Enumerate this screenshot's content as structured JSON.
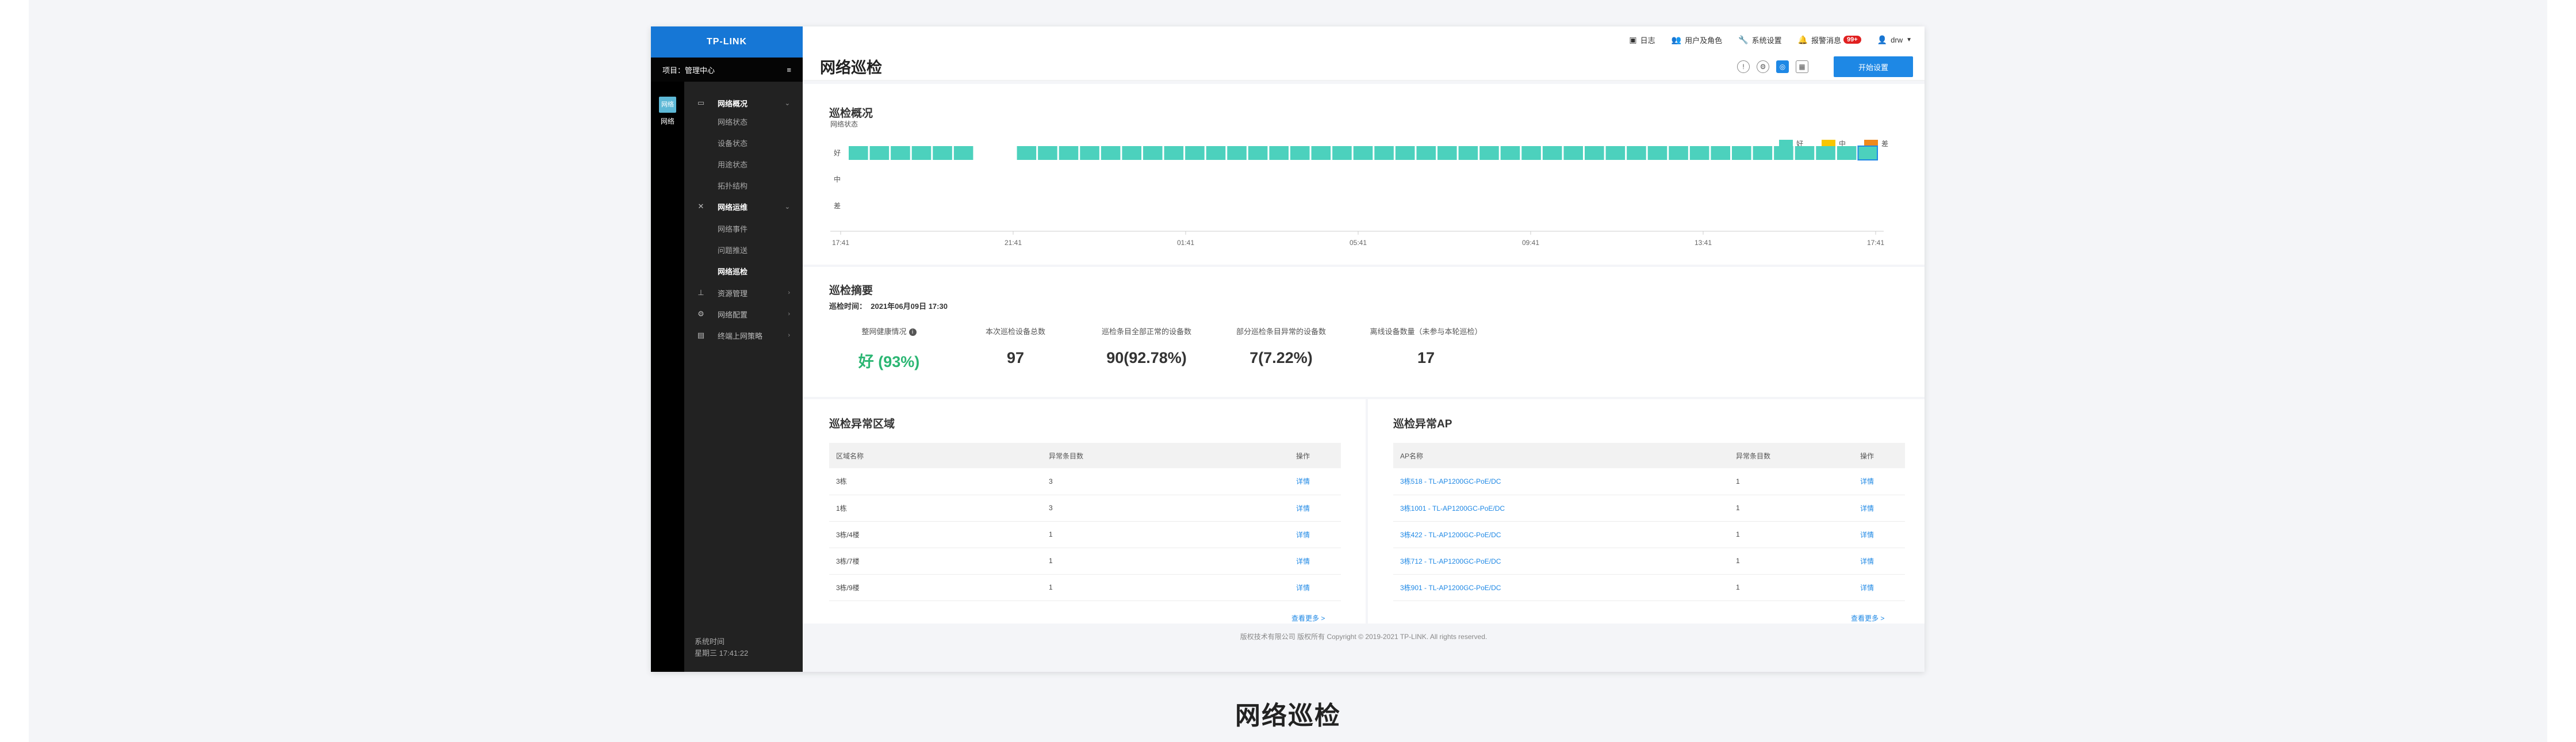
{
  "brand": {
    "logo": "TP-LINK"
  },
  "project": {
    "label": "项目：管理中心",
    "menu_icon": "hamburger-icon"
  },
  "rail": {
    "icon_text": "网络",
    "label": "网络"
  },
  "nav": {
    "groups": [
      {
        "label": "网络概况",
        "icon": "monitor-icon",
        "children": [
          "网络状态",
          "设备状态",
          "用途状态",
          "拓扑结构"
        ]
      },
      {
        "label": "网络运维",
        "icon": "tools-icon",
        "children": [
          "网络事件",
          "问题推送",
          "网络巡检"
        ]
      },
      {
        "label": "资源管理",
        "icon": "sitemap-icon",
        "children": []
      },
      {
        "label": "网络配置",
        "icon": "gear-icon",
        "children": []
      },
      {
        "label": "终端上网策略",
        "icon": "terminal-icon",
        "children": []
      }
    ],
    "active_child": "网络巡检"
  },
  "system_time": {
    "label": "系统时间",
    "value": "星期三 17:41:22"
  },
  "topbar": {
    "log": "日志",
    "users": "用户及角色",
    "settings": "系统设置",
    "alerts": "报警消息",
    "alert_count": "99+",
    "user": "drw"
  },
  "page": {
    "title": "网络巡检",
    "start_button": "开始设置"
  },
  "overview": {
    "title": "巡检概况"
  },
  "chart_data": {
    "type": "bar",
    "title": "巡检概况",
    "ylabel": "网络状态",
    "y_categories": [
      "好",
      "中",
      "差"
    ],
    "x_ticks": [
      "17:41",
      "21:41",
      "01:41",
      "05:41",
      "09:41",
      "13:41",
      "17:41"
    ],
    "legend": [
      {
        "label": "好",
        "color": "#4cd1bd"
      },
      {
        "label": "中",
        "color": "#f8c600"
      },
      {
        "label": "差",
        "color": "#f08a1c"
      }
    ],
    "legend_position": "top-right",
    "bars": 48,
    "gap_after": 6,
    "values": [
      "好",
      "好",
      "好",
      "好",
      "好",
      "好",
      "",
      "好",
      "好",
      "好",
      "好",
      "好",
      "好",
      "好",
      "好",
      "好",
      "好",
      "好",
      "好",
      "好",
      "好",
      "好",
      "好",
      "好",
      "好",
      "好",
      "好",
      "好",
      "好",
      "好",
      "好",
      "好",
      "好",
      "好",
      "好",
      "好",
      "好",
      "好",
      "好",
      "好",
      "好",
      "好",
      "好",
      "好",
      "好",
      "好",
      "好",
      "好"
    ],
    "highlight_last": true
  },
  "summary": {
    "title": "巡检摘要",
    "time_label": "巡检时间：",
    "time_value": "2021年06月09日 17:30",
    "stats": [
      {
        "label": "整网健康情况",
        "value": "好 (93%)"
      },
      {
        "label": "本次巡检设备总数",
        "value": "97"
      },
      {
        "label": "巡检条目全部正常的设备数",
        "value": "90(92.78%)"
      },
      {
        "label": "部分巡检条目异常的设备数",
        "value": "7(7.22%)"
      },
      {
        "label": "离线设备数量（未参与本轮巡检）",
        "value": "17"
      }
    ]
  },
  "areas": {
    "title": "巡检异常区域",
    "headers": [
      "区域名称",
      "异常条目数",
      "操作"
    ],
    "rows": [
      [
        "3栋",
        "3",
        "详情"
      ],
      [
        "1栋",
        "3",
        "详情"
      ],
      [
        "3栋/4楼",
        "1",
        "详情"
      ],
      [
        "3栋/7楼",
        "1",
        "详情"
      ],
      [
        "3栋/9楼",
        "1",
        "详情"
      ]
    ],
    "more": "查看更多 >"
  },
  "aps": {
    "title": "巡检异常AP",
    "headers": [
      "AP名称",
      "异常条目数",
      "操作"
    ],
    "rows": [
      [
        "3栋518 - TL-AP1200GC-PoE/DC",
        "1",
        "详情"
      ],
      [
        "3栋1001 - TL-AP1200GC-PoE/DC",
        "1",
        "详情"
      ],
      [
        "3栋422 - TL-AP1200GC-PoE/DC",
        "1",
        "详情"
      ],
      [
        "3栋712 - TL-AP1200GC-PoE/DC",
        "1",
        "详情"
      ],
      [
        "3栋901 - TL-AP1200GC-PoE/DC",
        "1",
        "详情"
      ]
    ],
    "more": "查看更多 >"
  },
  "footer": "版权技术有限公司 版权所有 Copyright © 2019-2021 TP-LINK. All rights reserved.",
  "caption": "网络巡检"
}
